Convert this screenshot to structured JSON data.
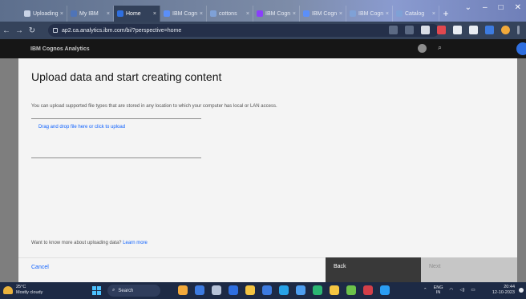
{
  "browser": {
    "tabs": [
      {
        "label": "Uploading",
        "color": "#c9d3e6"
      },
      {
        "label": "My IBM",
        "color": "#4f74b8"
      },
      {
        "label": "Home",
        "color": "#2f6fe0",
        "active": true
      },
      {
        "label": "IBM Cogn",
        "color": "#5b8ff9"
      },
      {
        "label": "cottons",
        "color": "#7fa1d6"
      },
      {
        "label": "IBM Cogn",
        "color": "#8a3ffc"
      },
      {
        "label": "IBM Cogn",
        "color": "#5b8ff9"
      },
      {
        "label": "IBM Cogn",
        "color": "#7fa1d6"
      },
      {
        "label": "Catalog",
        "color": "#7fa1d6"
      }
    ],
    "new_tab": "+",
    "address": "ap2.ca.analytics.ibm.com/bi/?perspective=home",
    "window_controls": [
      "⌄",
      "–",
      "□",
      "✕"
    ]
  },
  "app": {
    "brand": "IBM Cognos Analytics",
    "search_icon": "⌕"
  },
  "dialog": {
    "title": "Upload data and start creating content",
    "description": "You can upload supported file types that are stored in any location to which your computer has local or LAN access.",
    "dropzone_text": "Drag and drop file here or click to upload",
    "learn_prefix": "Want to know more about uploading data?",
    "learn_link": "Learn more",
    "cancel": "Cancel",
    "back": "Back",
    "next": "Next"
  },
  "taskbar": {
    "temperature": "25°C",
    "weather": "Mostly cloudy",
    "search_label": "Search",
    "lang_top": "ENG",
    "lang_bottom": "IN",
    "time": "20:44",
    "date": "12-10-2023",
    "apps": [
      "#f2a93b",
      "#3d7be0",
      "#b7c3d8",
      "#2f6fe0",
      "#f3c342",
      "#3d7be0",
      "#27a2e8",
      "#4d9ef0",
      "#2bb673",
      "#f4c542",
      "#6cc24a",
      "#d33f49",
      "#2a9df4"
    ]
  }
}
